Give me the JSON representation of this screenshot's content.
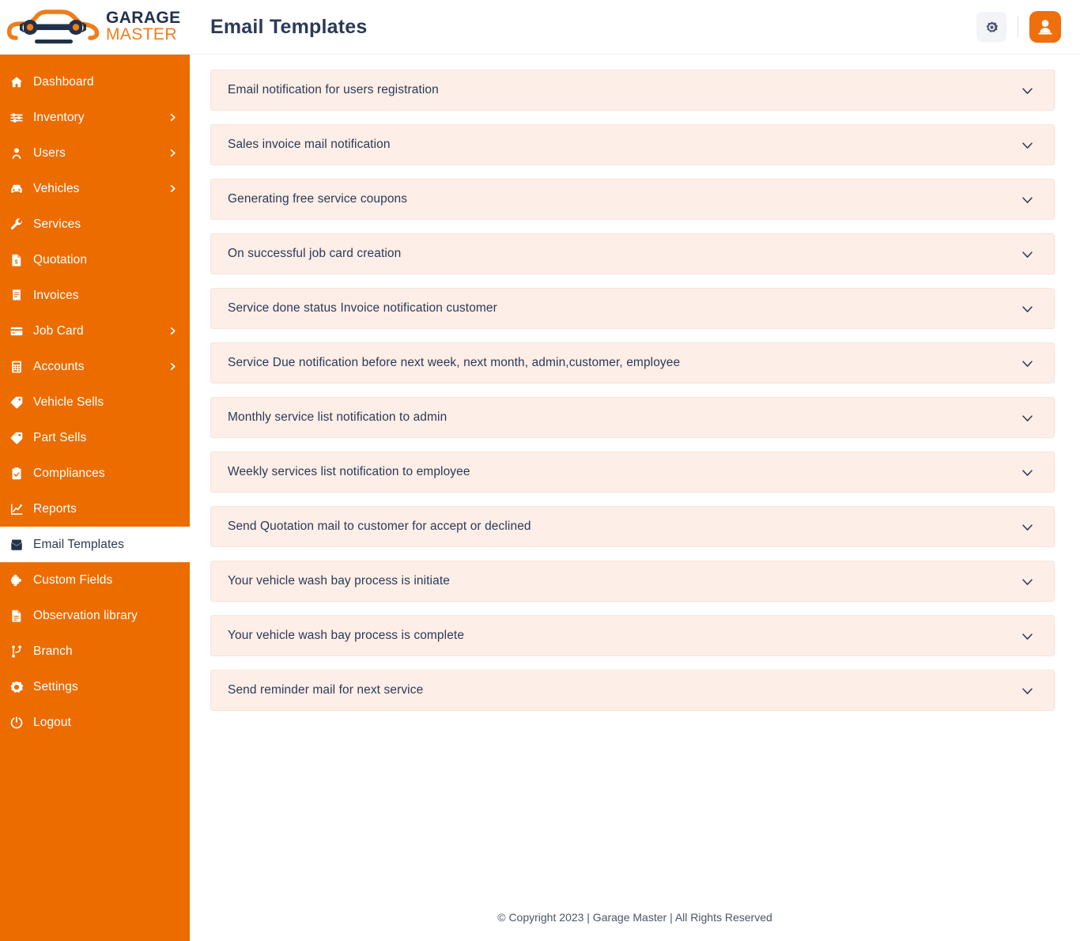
{
  "brand": {
    "logo_icon": "car-wrench-logo-icon",
    "name_top": "GARAGE",
    "name_bottom": "MASTER",
    "color_orange": "#ec6c00",
    "color_navy": "#22314a"
  },
  "header": {
    "title": "Email Templates",
    "settings_icon": "gear-icon",
    "avatar_icon": "user-avatar-icon"
  },
  "sidebar": {
    "items": [
      {
        "label": "Dashboard",
        "icon": "home-icon",
        "has_arrow": false,
        "active": false
      },
      {
        "label": "Inventory",
        "icon": "sliders-icon",
        "has_arrow": true,
        "active": false
      },
      {
        "label": "Users",
        "icon": "user-icon",
        "has_arrow": true,
        "active": false
      },
      {
        "label": "Vehicles",
        "icon": "car-icon",
        "has_arrow": true,
        "active": false
      },
      {
        "label": "Services",
        "icon": "wrench-icon",
        "has_arrow": false,
        "active": false
      },
      {
        "label": "Quotation",
        "icon": "file-dollar-icon",
        "has_arrow": false,
        "active": false
      },
      {
        "label": "Invoices",
        "icon": "receipt-icon",
        "has_arrow": false,
        "active": false
      },
      {
        "label": "Job Card",
        "icon": "card-icon",
        "has_arrow": true,
        "active": false
      },
      {
        "label": "Accounts",
        "icon": "calculator-icon",
        "has_arrow": true,
        "active": false
      },
      {
        "label": "Vehicle Sells",
        "icon": "tag-icon",
        "has_arrow": false,
        "active": false
      },
      {
        "label": "Part Sells",
        "icon": "tag-icon",
        "has_arrow": false,
        "active": false
      },
      {
        "label": "Compliances",
        "icon": "clipboard-check-icon",
        "has_arrow": false,
        "active": false
      },
      {
        "label": "Reports",
        "icon": "chart-line-icon",
        "has_arrow": false,
        "active": false
      },
      {
        "label": "Email Templates",
        "icon": "mail-icon",
        "has_arrow": false,
        "active": true
      },
      {
        "label": "Custom Fields",
        "icon": "puzzle-icon",
        "has_arrow": false,
        "active": false
      },
      {
        "label": "Observation library",
        "icon": "document-icon",
        "has_arrow": false,
        "active": false
      },
      {
        "label": "Branch",
        "icon": "branch-icon",
        "has_arrow": false,
        "active": false
      },
      {
        "label": "Settings",
        "icon": "gear-icon",
        "has_arrow": false,
        "active": false
      },
      {
        "label": "Logout",
        "icon": "power-icon",
        "has_arrow": false,
        "active": false
      }
    ]
  },
  "main": {
    "accordion": [
      {
        "label": "Email notification for users registration",
        "chevron": "chevron-down-icon",
        "expanded": false
      },
      {
        "label": "Sales invoice mail notification",
        "chevron": "chevron-down-icon",
        "expanded": false
      },
      {
        "label": "Generating free service coupons",
        "chevron": "chevron-down-icon",
        "expanded": false
      },
      {
        "label": "On successful job card creation",
        "chevron": "chevron-down-icon",
        "expanded": false
      },
      {
        "label": "Service done status Invoice notification customer",
        "chevron": "chevron-down-icon",
        "expanded": false
      },
      {
        "label": "Service Due notification before next week, next month, admin,customer, employee",
        "chevron": "chevron-down-icon",
        "expanded": false
      },
      {
        "label": "Monthly service list notification to admin",
        "chevron": "chevron-down-icon",
        "expanded": false
      },
      {
        "label": "Weekly services list notification to employee",
        "chevron": "chevron-down-icon",
        "expanded": false
      },
      {
        "label": "Send Quotation mail to customer for accept or declined",
        "chevron": "chevron-down-icon",
        "expanded": false
      },
      {
        "label": "Your vehicle wash bay process is initiate",
        "chevron": "chevron-down-icon",
        "expanded": false
      },
      {
        "label": "Your vehicle wash bay process is complete",
        "chevron": "chevron-down-icon",
        "expanded": false
      },
      {
        "label": "Send reminder mail for next service",
        "chevron": "chevron-down-icon",
        "expanded": false
      }
    ]
  },
  "footer": {
    "text": "© Copyright 2023 | Garage Master | All Rights Reserved"
  },
  "colors": {
    "sidebar_orange": "#ec6c00",
    "accordion_bg": "#fdeee8",
    "text_navy": "#2b3a55",
    "avatar_orange": "#ee6f0b"
  }
}
